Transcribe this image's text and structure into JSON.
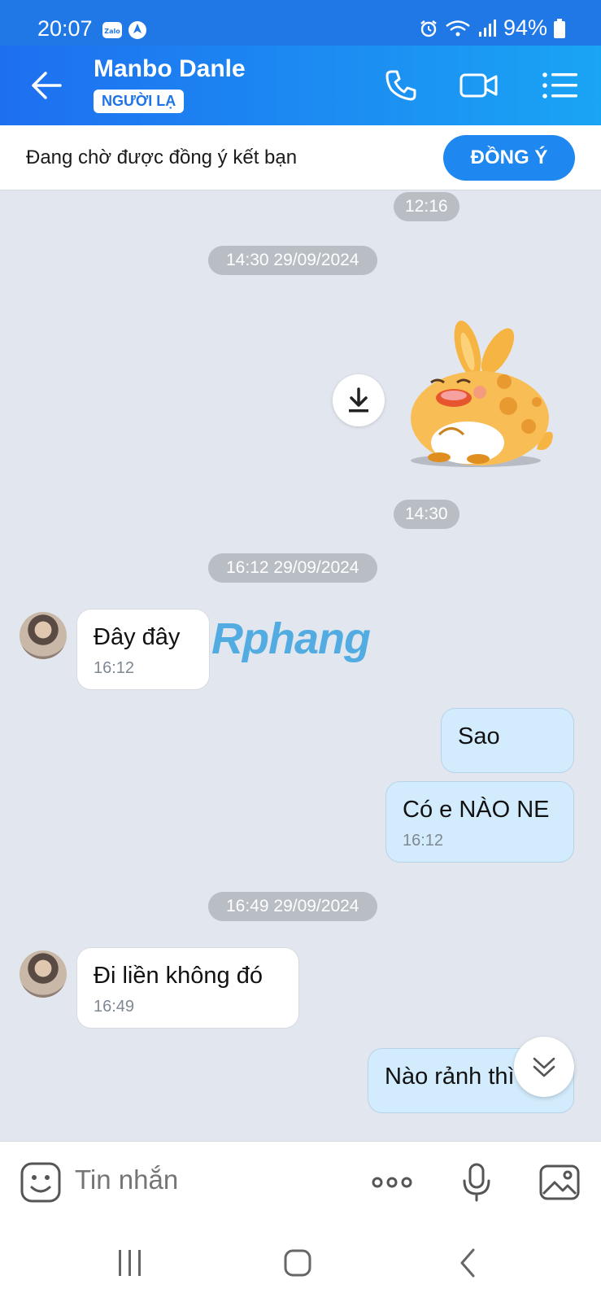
{
  "status_bar": {
    "time": "20:07",
    "battery": "94%",
    "app_icon": "zalo-icon"
  },
  "header": {
    "title": "Manbo Danle",
    "badge": "NGƯỜI LẠ"
  },
  "request_bar": {
    "text": "Đang chờ được đồng ý kết bạn",
    "button": "ĐỒNG Ý"
  },
  "chat": {
    "time_1216": "12:16",
    "sep_1": "14:30 29/09/2024",
    "sticker_time": "14:30",
    "sep_2": "16:12 29/09/2024",
    "msg_1": {
      "text": "Đây đây",
      "time": "16:12"
    },
    "watermark": "Rphang",
    "msg_2": {
      "text": "Sao"
    },
    "msg_3": {
      "text": "Có e NÀO NE",
      "time": "16:12"
    },
    "sep_3": "16:49 29/09/2024",
    "msg_4": {
      "text": "Đi liền không đó",
      "time": "16:49"
    },
    "msg_5": {
      "text": "Nào rảnh thì"
    }
  },
  "composer": {
    "placeholder": "Tin nhắn"
  },
  "colors": {
    "brand": "#1e73e8",
    "out_bubble": "#d3ecfd",
    "chat_bg": "#e2e6ee"
  }
}
